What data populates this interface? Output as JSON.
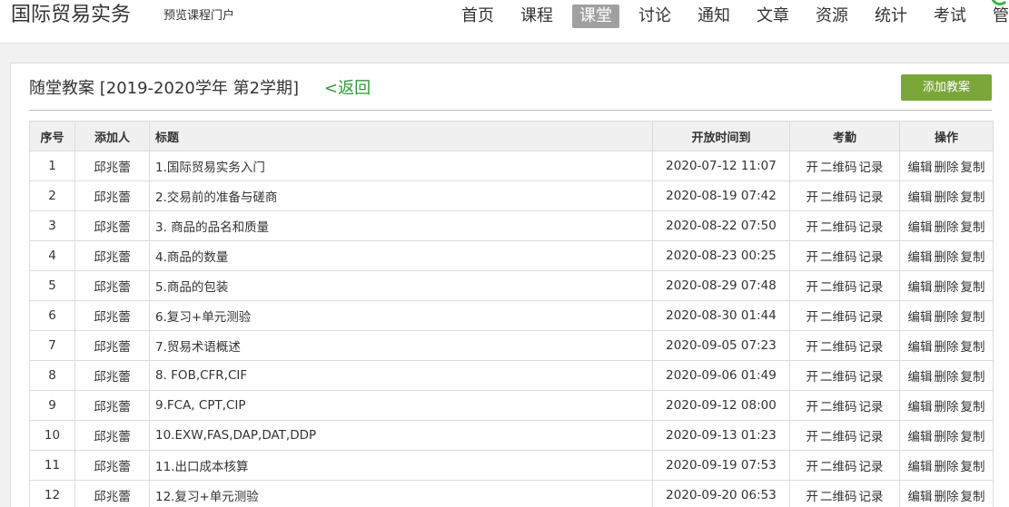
{
  "header": {
    "site_title": "国际贸易实务",
    "portal_link": "预览课程门户",
    "nav": [
      {
        "label": "首页",
        "name": "nav-home",
        "active": false
      },
      {
        "label": "课程",
        "name": "nav-course",
        "active": false
      },
      {
        "label": "课堂",
        "name": "nav-classroom",
        "active": true
      },
      {
        "label": "讨论",
        "name": "nav-discussion",
        "active": false
      },
      {
        "label": "通知",
        "name": "nav-notice",
        "active": false
      },
      {
        "label": "文章",
        "name": "nav-article",
        "active": false
      },
      {
        "label": "资源",
        "name": "nav-resource",
        "active": false
      },
      {
        "label": "统计",
        "name": "nav-statistics",
        "active": false
      },
      {
        "label": "考试",
        "name": "nav-exam",
        "active": false
      },
      {
        "label": "管理",
        "name": "nav-manage",
        "active": false
      }
    ]
  },
  "panel": {
    "title": "随堂教案 [2019-2020学年 第2学期]",
    "back_link": "<返回",
    "add_button": "添加教案"
  },
  "table": {
    "headers": {
      "index": "序号",
      "author": "添加人",
      "title": "标题",
      "open_until": "开放时间到",
      "attendance": "考勤",
      "actions": "操作"
    },
    "attendance_labels": [
      "开",
      "二维码",
      "记录"
    ],
    "action_labels": [
      "编辑",
      "删除",
      "复制"
    ],
    "rows": [
      {
        "index": "1",
        "author": "邱兆蕾",
        "title": "1.国际贸易实务入门",
        "open_until": "2020-07-12 11:07"
      },
      {
        "index": "2",
        "author": "邱兆蕾",
        "title": "2.交易前的准备与磋商",
        "open_until": "2020-08-19 07:42"
      },
      {
        "index": "3",
        "author": "邱兆蕾",
        "title": "3. 商品的品名和质量",
        "open_until": "2020-08-22 07:50"
      },
      {
        "index": "4",
        "author": "邱兆蕾",
        "title": "4.商品的数量",
        "open_until": "2020-08-23 00:25"
      },
      {
        "index": "5",
        "author": "邱兆蕾",
        "title": "5.商品的包装",
        "open_until": "2020-08-29 07:48"
      },
      {
        "index": "6",
        "author": "邱兆蕾",
        "title": "6.复习+单元测验",
        "open_until": "2020-08-30 01:44"
      },
      {
        "index": "7",
        "author": "邱兆蕾",
        "title": "7.贸易术语概述",
        "open_until": "2020-09-05 07:23"
      },
      {
        "index": "8",
        "author": "邱兆蕾",
        "title": "8. FOB,CFR,CIF",
        "open_until": "2020-09-06 01:49"
      },
      {
        "index": "9",
        "author": "邱兆蕾",
        "title": "9.FCA, CPT,CIP",
        "open_until": "2020-09-12 08:00"
      },
      {
        "index": "10",
        "author": "邱兆蕾",
        "title": "10.EXW,FAS,DAP,DAT,DDP",
        "open_until": "2020-09-13 01:23"
      },
      {
        "index": "11",
        "author": "邱兆蕾",
        "title": "11.出口成本核算",
        "open_until": "2020-09-19 07:53"
      },
      {
        "index": "12",
        "author": "邱兆蕾",
        "title": "12.复习+单元测验",
        "open_until": "2020-09-20 06:53"
      }
    ]
  },
  "colors": {
    "accent_green": "#7aa63a",
    "link_green": "#2e9a3a",
    "nav_active_bg": "#a0a0a0"
  }
}
